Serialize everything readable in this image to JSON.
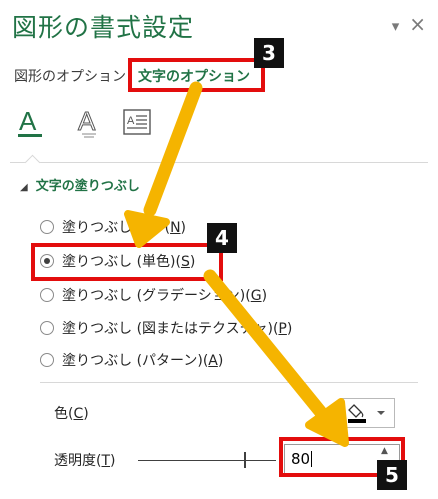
{
  "pane": {
    "title": "図形の書式設定",
    "collapse_glyph": "▾",
    "close_glyph": "×"
  },
  "tabs": [
    {
      "label": "図形のオプション",
      "active": false
    },
    {
      "label": "文字のオプション",
      "active": true
    }
  ],
  "icon_tabs": [
    "text-fill-outline-icon",
    "text-effects-icon",
    "textbox-icon"
  ],
  "section": {
    "toggle_glyph": "◢",
    "title": "文字の塗りつぶし"
  },
  "fill_options": [
    {
      "pre": "塗りつぶしなし (",
      "key": "N",
      "post": ")",
      "selected": false
    },
    {
      "pre": "塗りつぶし (単色)(",
      "key": "S",
      "post": ")",
      "selected": true
    },
    {
      "pre": "塗りつぶし (グラデーション)(",
      "key": "G",
      "post": ")",
      "selected": false
    },
    {
      "pre": "塗りつぶし (図またはテクスチャ)(",
      "key": "P",
      "post": ")",
      "selected": false
    },
    {
      "pre": "塗りつぶし (パターン)(",
      "key": "A",
      "post": ")",
      "selected": false
    }
  ],
  "color": {
    "pre": "色(",
    "key": "C",
    "post": ")",
    "swatch": "#000000"
  },
  "transparency": {
    "pre": "透明度(",
    "key": "T",
    "post": ")",
    "value": "80"
  },
  "annotations": {
    "badges": [
      "3",
      "4",
      "5"
    ],
    "highlight_color": "#e30d0d",
    "arrow_color": "#f5b400"
  }
}
